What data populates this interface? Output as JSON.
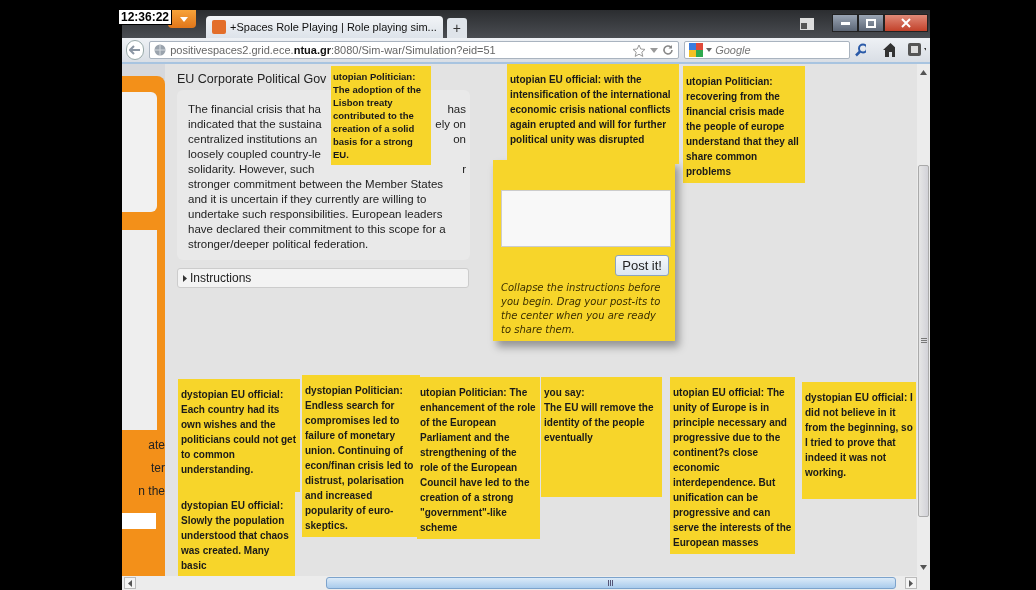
{
  "clock": "12:36:22",
  "browser": {
    "tab_title": "+Spaces Role Playing | Role playing sim...",
    "new_tab": "+",
    "url": "positivespaces2.grid.ece.**ntua.gr**:8080/Sim-war/Simulation?eid=51",
    "search_placeholder": "Google"
  },
  "sidebar": {
    "fragments": [
      "ate",
      "ter",
      "n the"
    ]
  },
  "page": {
    "title": "EU Corporate Political Gov",
    "description": [
      {
        "left": "The financial crisis that ha",
        "right": "has"
      },
      {
        "left": "indicated that the sustaina",
        "right": "ely on"
      },
      {
        "left": "centralized institutions an",
        "right": "on"
      },
      {
        "left": "loosely coupled country-le"
      },
      {
        "left": "solidarity. However, such",
        "right": "r"
      },
      {
        "left": "stronger commitment between the Member States"
      },
      {
        "left": "and it is uncertain if they currently are willing to"
      },
      {
        "left": "undertake such responsibilities. European leaders"
      },
      {
        "left": "have declared their commitment to this scope for a"
      },
      {
        "left": "stronger/deeper political federation."
      }
    ],
    "instructions": "Instructions"
  },
  "post_it_form": {
    "button": "Post it!",
    "hint": "Collapse the instructions before you begin. Drag your post-its to the center when you are ready to share them."
  },
  "notes": [
    {
      "text": "utopian Politician: The adoption of the Lisbon treaty contributed to the creation of a solid basis for a strong EU."
    },
    {
      "text": "utopian EU official: with the intensification of the international economic crisis national conflicts again erupted and will for further political unity was disrupted"
    },
    {
      "text": "utopian Politician: recovering from the financial crisis made the people of europe understand that they all share common problems"
    },
    {
      "text": "dystopian EU official: Each country had its own wishes and the politicians could not get to common understanding."
    },
    {
      "text": "dystopian EU official: Slowly the population understood that chaos was created. Many basic"
    },
    {
      "text": "dystopian Politician: Endless search for compromises led to failure of monetary union. Continuing of econ/finan crisis led to distrust, polarisation and increased popularity of euro-skeptics."
    },
    {
      "text": "utopian Politician: The enhancement of the role of the European Parliament and the strengthening of the role of the European Council have led to the creation of a strong \"government\"-like scheme"
    },
    {
      "text": "you say:\nThe EU will remove the identity of the people eventually"
    },
    {
      "text": "utopian EU official: The unity of Europe is in principle necessary and progressive due to the continent?s close economic interdependence. But unification can be progressive and can serve the interests of the European masses"
    },
    {
      "text": "dystopian EU official: I did not believe in it from the beginning, so I tried to prove that indeed it was not working."
    }
  ]
}
